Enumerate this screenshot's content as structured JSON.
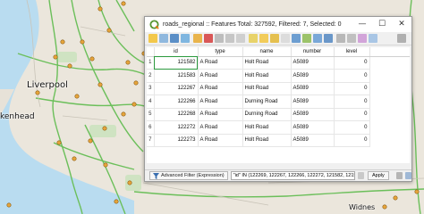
{
  "map": {
    "labels": {
      "liverpool": "Liverpool",
      "birkenhead": "kenhead",
      "widnes": "Widnes"
    }
  },
  "window": {
    "title": "roads_regional :: Features Total: 327592, Filtered: 7, Selected: 0",
    "controls": {
      "minimize": "—",
      "maximize": "☐",
      "close": "✕"
    }
  },
  "table": {
    "columns": [
      "id",
      "type",
      "name",
      "number",
      "level"
    ],
    "rows": [
      {
        "rn": "1",
        "id": "121582",
        "type": "A Road",
        "name": "Holt Road",
        "number": "A5089",
        "level": "0"
      },
      {
        "rn": "2",
        "id": "121583",
        "type": "A Road",
        "name": "Holt Road",
        "number": "A5089",
        "level": "0"
      },
      {
        "rn": "3",
        "id": "122267",
        "type": "A Road",
        "name": "Holt Road",
        "number": "A5089",
        "level": "0"
      },
      {
        "rn": "4",
        "id": "122266",
        "type": "A Road",
        "name": "Durning Road",
        "number": "A5089",
        "level": "0"
      },
      {
        "rn": "5",
        "id": "122268",
        "type": "A Road",
        "name": "Durning Road",
        "number": "A5089",
        "level": "0"
      },
      {
        "rn": "6",
        "id": "122272",
        "type": "A Road",
        "name": "Holt Road",
        "number": "A5089",
        "level": "0"
      },
      {
        "rn": "7",
        "id": "122273",
        "type": "A Road",
        "name": "Holt Road",
        "number": "A5089",
        "level": "0"
      }
    ]
  },
  "filter": {
    "button_label": "Advanced Filter (Expression)",
    "expression": "\"id\" IN (122269, 122267, 122266, 122272, 121582, 121583, 122273)",
    "apply_label": "Apply"
  }
}
